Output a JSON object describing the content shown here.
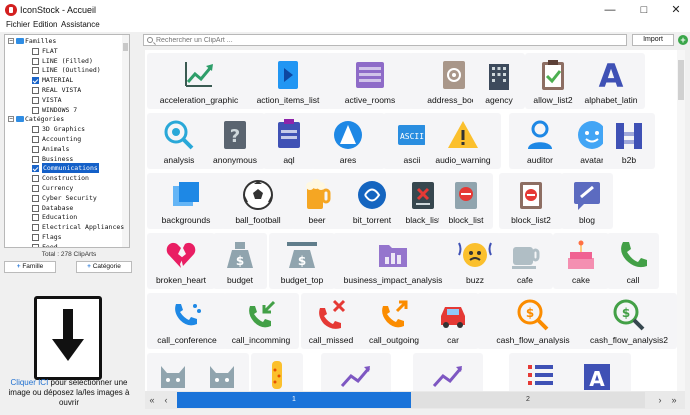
{
  "window": {
    "title": "IconStock - Accueil"
  },
  "menu": {
    "file": "Fichier",
    "edit": "Edition",
    "help": "Assistance"
  },
  "tree": {
    "families_label": "Familles",
    "families": [
      {
        "label": "FLAT",
        "checked": false
      },
      {
        "label": "LINE (Filled)",
        "checked": false
      },
      {
        "label": "LINE (Outlined)",
        "checked": false
      },
      {
        "label": "MATERIAL",
        "checked": true
      },
      {
        "label": "REAL VISTA",
        "checked": false
      },
      {
        "label": "VISTA",
        "checked": false
      },
      {
        "label": "WINDOWS 7",
        "checked": false
      }
    ],
    "categories_label": "Catégories",
    "categories": [
      {
        "label": "3D Graphics",
        "checked": false
      },
      {
        "label": "Accounting",
        "checked": false
      },
      {
        "label": "Animals",
        "checked": false
      },
      {
        "label": "Business",
        "checked": false
      },
      {
        "label": "Communications",
        "checked": true,
        "selected": true
      },
      {
        "label": "Construction",
        "checked": false
      },
      {
        "label": "Currency",
        "checked": false
      },
      {
        "label": "Cyber Security",
        "checked": false
      },
      {
        "label": "Database",
        "checked": false
      },
      {
        "label": "Education",
        "checked": false
      },
      {
        "label": "Electrical Appliances",
        "checked": false
      },
      {
        "label": "Flags",
        "checked": false
      },
      {
        "label": "Food",
        "checked": false
      }
    ]
  },
  "left": {
    "total": "Total : 278 ClipArts",
    "add_family": "Famille",
    "add_category": "Catégorie",
    "drop_link": "Cliquer ICI",
    "drop_text": " pour sélectionner une image ou déposez la/les images à ouvrir"
  },
  "toolbar": {
    "search_placeholder": "Rechercher un ClipArt ...",
    "import_label": "Import"
  },
  "icons": [
    {
      "label": "acceleration_graphic",
      "icon": "trending-up-icon",
      "color": "#3a5a52"
    },
    {
      "label": "action_items_list",
      "icon": "action-list-icon",
      "color": "#2196f3"
    },
    {
      "label": "active_rooms",
      "icon": "rooms-icon",
      "color": "#8e6bc8"
    },
    {
      "label": "address_book",
      "icon": "address-book-icon",
      "color": "#a9978a"
    },
    {
      "label": "agency",
      "icon": "building-icon",
      "color": "#3d4a5c"
    },
    {
      "label": "allow_list2",
      "icon": "clipboard-check-icon",
      "color": "#4caf50"
    },
    {
      "label": "alphabet_latin",
      "icon": "letter-a-icon",
      "color": "#3f51b5"
    },
    {
      "label": "analysis",
      "icon": "analysis-icon",
      "color": "#29a8d8"
    },
    {
      "label": "anonymous",
      "icon": "question-icon",
      "color": "#5a6470"
    },
    {
      "label": "aql",
      "icon": "aql-icon",
      "color": "#3f51b5"
    },
    {
      "label": "ares",
      "icon": "ares-icon",
      "color": "#1e88e5"
    },
    {
      "label": "ascii",
      "icon": "ascii-icon",
      "color": "#2a8ee0"
    },
    {
      "label": "audio_warning",
      "icon": "warning-icon",
      "color": "#fbc02d"
    },
    {
      "label": "auditor",
      "icon": "person-icon",
      "color": "#1e88e5"
    },
    {
      "label": "avatar",
      "icon": "avatar-icon",
      "color": "#42a5f5"
    },
    {
      "label": "b2b",
      "icon": "b2b-icon",
      "color": "#3f51b5"
    },
    {
      "label": "backgrounds",
      "icon": "backgrounds-icon",
      "color": "#1e88e5"
    },
    {
      "label": "ball_football",
      "icon": "football-icon",
      "color": "#333333"
    },
    {
      "label": "beer",
      "icon": "beer-icon",
      "color": "#f5a623"
    },
    {
      "label": "bit_torrent",
      "icon": "torrent-icon",
      "color": "#1565c0"
    },
    {
      "label": "black_list",
      "icon": "black-list-icon",
      "color": "#37474f"
    },
    {
      "label": "block_list",
      "icon": "block-list-icon",
      "color": "#90a4ae"
    },
    {
      "label": "block_list2",
      "icon": "block-list2-icon",
      "color": "#8d6e63"
    },
    {
      "label": "blog",
      "icon": "blog-icon",
      "color": "#5c6bc0"
    },
    {
      "label": "broken_heart",
      "icon": "broken-heart-icon",
      "color": "#e91e63"
    },
    {
      "label": "budget",
      "icon": "money-bag-icon",
      "color": "#90a4ae"
    },
    {
      "label": "budget_top",
      "icon": "budget-top-icon",
      "color": "#90a4ae"
    },
    {
      "label": "business_impact_analysis",
      "icon": "folder-chart-icon",
      "color": "#9575cd"
    },
    {
      "label": "buzz",
      "icon": "buzz-icon",
      "color": "#fbc02d"
    },
    {
      "label": "cafe",
      "icon": "cup-icon",
      "color": "#b0bec5"
    },
    {
      "label": "cake",
      "icon": "cake-icon",
      "color": "#f48fb1"
    },
    {
      "label": "call",
      "icon": "phone-icon",
      "color": "#43a047"
    },
    {
      "label": "call_conference",
      "icon": "phone-conference-icon",
      "color": "#1e88e5"
    },
    {
      "label": "call_incomming",
      "icon": "phone-incoming-icon",
      "color": "#43a047"
    },
    {
      "label": "call_missed",
      "icon": "phone-missed-icon",
      "color": "#e53935"
    },
    {
      "label": "call_outgoing",
      "icon": "phone-outgoing-icon",
      "color": "#fb8c00"
    },
    {
      "label": "car",
      "icon": "car-icon",
      "color": "#e53935"
    },
    {
      "label": "cash_flow_analysis",
      "icon": "cash-flow-icon",
      "color": "#fb8c00"
    },
    {
      "label": "cash_flow_analysis2",
      "icon": "cash-flow2-icon",
      "color": "#43a047"
    },
    {
      "label": "",
      "icon": "cat-icon",
      "color": "#90a4ae"
    },
    {
      "label": "",
      "icon": "cat2-icon",
      "color": "#90a4ae"
    },
    {
      "label": "",
      "icon": "bottle-icon",
      "color": "#fbc02d"
    },
    {
      "label": "",
      "icon": "chart-up-icon",
      "color": "#7e57c2"
    },
    {
      "label": "",
      "icon": "chart-up2-icon",
      "color": "#7e57c2"
    },
    {
      "label": "",
      "icon": "list-icon",
      "color": "#e53935"
    },
    {
      "label": "",
      "icon": "letter-a2-icon",
      "color": "#3f51b5"
    }
  ],
  "pager": {
    "page1": "1",
    "page2": "2"
  }
}
